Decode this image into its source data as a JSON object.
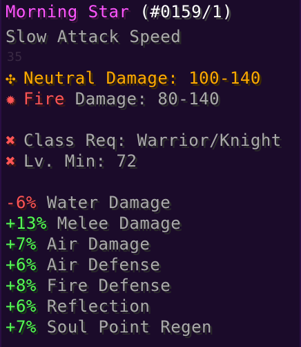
{
  "item": {
    "name": "Morning Star",
    "id": "(#0159/1)",
    "attack_speed": "Slow Attack Speed"
  },
  "damage": {
    "neutral_icon": "✣",
    "neutral": "Neutral Damage: 100-140",
    "fire_icon": "✹",
    "fire_label": "Fire",
    "fire_rest": " Damage: 80-140"
  },
  "requirements": {
    "class_icon": "✖",
    "class": "Class Req: Warrior/Knight",
    "level_icon": "✖",
    "level": "Lv. Min: 72"
  },
  "stats": [
    {
      "value": "-6%",
      "label": " Water Damage",
      "color": "#ff5555"
    },
    {
      "value": "+13%",
      "label": " Melee Damage",
      "color": "#55ff55"
    },
    {
      "value": "+7%",
      "label": " Air Damage",
      "color": "#55ff55"
    },
    {
      "value": "+6%",
      "label": " Air Defense",
      "color": "#55ff55"
    },
    {
      "value": "+8%",
      "label": " Fire Defense",
      "color": "#55ff55"
    },
    {
      "value": "+6%",
      "label": " Reflection",
      "color": "#55ff55"
    },
    {
      "value": "+7%",
      "label": " Soul Point Regen",
      "color": "#55ff55"
    }
  ],
  "background": {
    "faint_number": "35"
  }
}
